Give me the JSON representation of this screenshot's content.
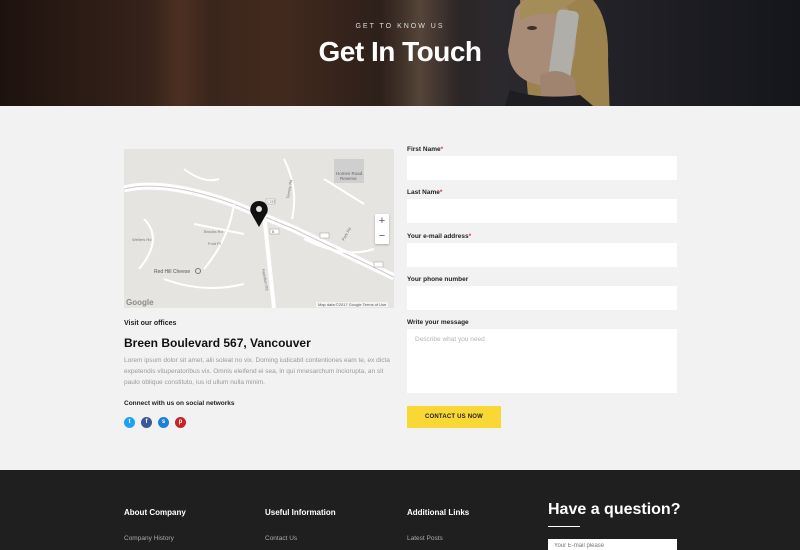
{
  "hero": {
    "eyebrow": "GET TO KNOW US",
    "title": "Get In Touch"
  },
  "map": {
    "labels": {
      "homes_road": "Homes Road",
      "reserve": "Reserve",
      "red_hill": "Red Hill Cheese",
      "road_1": "Brooks Rd",
      "road_2": "Fruit Pl",
      "road_3": "Wellers Rd",
      "road_4": "Hamilton Rd",
      "road_5": "Tierney Rd",
      "road_6": "Park Rd",
      "route_a": "C787",
      "route_b": "B"
    },
    "zoom_in": "+",
    "zoom_out": "−",
    "logo": "Google",
    "credit": "Map data ©2017 Google    Terms of Use"
  },
  "office": {
    "visit_label": "Visit our offices",
    "address": "Breen Boulevard 567, Vancouver",
    "description": "Lorem ipsum dolor sit amet, alii soleat no vix. Doming iudicabit contentiones eam te, ex dicta expetendis vituperatoribus vix. Omnis eleifend ei sea, in qui mnesarchum inciorupta, an sit paulo oblique constituto, ius id ullum nulla minim.",
    "connect_label": "Connect with us on social networks",
    "socials": [
      {
        "name": "twitter",
        "glyph": "t",
        "color": "#1da1f2"
      },
      {
        "name": "facebook",
        "glyph": "f",
        "color": "#3b5998"
      },
      {
        "name": "skype",
        "glyph": "s",
        "color": "#1d82d6"
      },
      {
        "name": "pinterest",
        "glyph": "p",
        "color": "#cb2027"
      }
    ]
  },
  "form": {
    "first_name_label": "First Name",
    "last_name_label": "Last Name",
    "email_label": "Your e-mail address",
    "phone_label": "Your phone number",
    "message_label": "Write your message",
    "required_mark": "*",
    "message_placeholder": "Describe what you need",
    "submit_label": "CONTACT US NOW"
  },
  "footer": {
    "col1_title": "About Company",
    "col1_link": "Company History",
    "col2_title": "Useful Information",
    "col2_link": "Contact Us",
    "col3_title": "Additional Links",
    "col3_link": "Latest Posts",
    "question_title": "Have a question?",
    "email_placeholder": "Your E-mail please"
  }
}
